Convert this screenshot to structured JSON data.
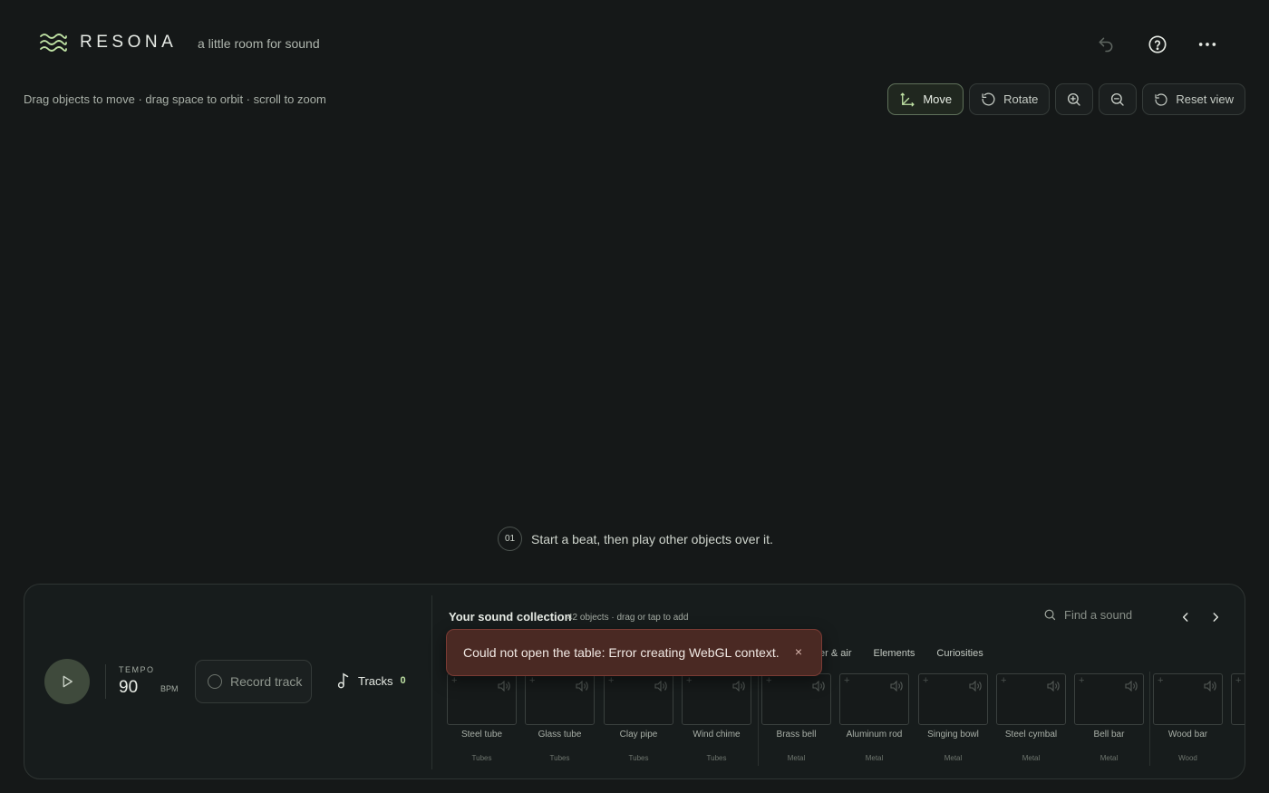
{
  "header": {
    "brand": "RESONA",
    "tagline": "a little room for sound"
  },
  "hint": "Drag objects to move · drag space to orbit · scroll to zoom",
  "toolbar": {
    "move_label": "Move",
    "rotate_label": "Rotate",
    "reset_label": "Reset view",
    "active_mode": "Move"
  },
  "step": {
    "number": "01",
    "text": "Start a beat, then play other objects over it."
  },
  "transport": {
    "tempo_label": "TEMPO",
    "tempo_value": "90",
    "bpm_label": "BPM",
    "record_label": "Record track",
    "tracks_label": "Tracks",
    "tracks_count": "0"
  },
  "collection": {
    "title": "Your sound collection",
    "subtitle": "42 objects · drag or tap to add",
    "search_placeholder": "Find a sound",
    "categories": [
      "ter & air",
      "Elements",
      "Curiosities"
    ],
    "items": [
      {
        "name": "Steel tube",
        "category": "Tubes"
      },
      {
        "name": "Glass tube",
        "category": "Tubes"
      },
      {
        "name": "Clay pipe",
        "category": "Tubes"
      },
      {
        "name": "Wind chime",
        "category": "Tubes"
      },
      {
        "name": "Brass bell",
        "category": "Metal"
      },
      {
        "name": "Aluminum rod",
        "category": "Metal"
      },
      {
        "name": "Singing bowl",
        "category": "Metal"
      },
      {
        "name": "Steel cymbal",
        "category": "Metal"
      },
      {
        "name": "Bell bar",
        "category": "Metal"
      },
      {
        "name": "Wood bar",
        "category": "Wood"
      }
    ]
  },
  "toast": {
    "message": "Could not open the table: Error creating WebGL context.",
    "close": "×"
  },
  "colors": {
    "background": "#151818",
    "accent": "#bfe2a4",
    "error_bg": "#4a2923"
  }
}
